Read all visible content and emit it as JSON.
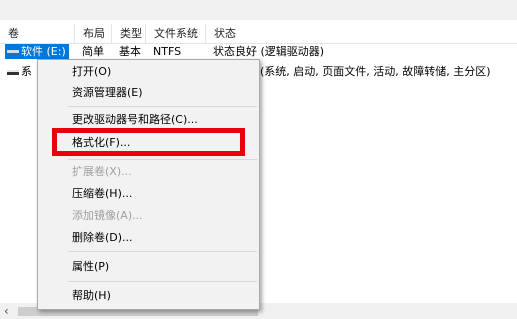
{
  "table": {
    "columns": [
      "卷",
      "布局",
      "类型",
      "文件系统",
      "状态"
    ],
    "rows": [
      {
        "volume": "软件 (E:)",
        "layout": "简单",
        "type": "基本",
        "fs": "NTFS",
        "status": "状态良好 (逻辑驱动器)",
        "selected": true
      },
      {
        "volume": "系",
        "layout": "",
        "type": "",
        "fs": "",
        "status": "(系统, 启动, 页面文件, 活动, 故障转储, 主分区)",
        "selected": false
      }
    ]
  },
  "context_menu": {
    "items": [
      "打开(O)",
      "资源管理器(E)",
      "更改驱动器号和路径(C)...",
      "格式化(F)...",
      "扩展卷(X)...",
      "压缩卷(H)...",
      "添加镜像(A)...",
      "删除卷(D)...",
      "属性(P)",
      "帮助(H)"
    ],
    "disabled": [
      "扩展卷(X)...",
      "添加镜像(A)..."
    ],
    "highlighted_item": "格式化(F)..."
  },
  "colors": {
    "selection": "#0078d7",
    "highlight_border": "#e8000b",
    "menu_bg": "#f2f2f2"
  },
  "icons": [
    "disk-icon",
    "scroll-left-icon"
  ]
}
